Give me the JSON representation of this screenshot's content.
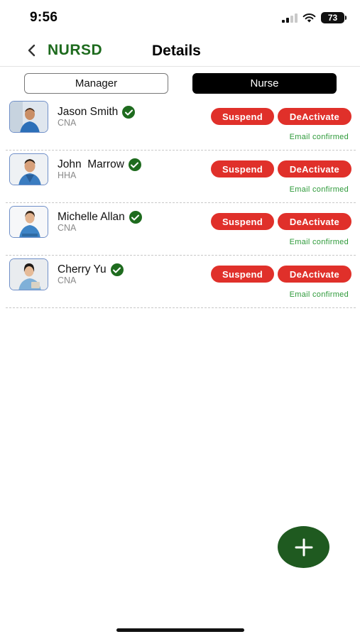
{
  "status_bar": {
    "time": "9:56",
    "battery": "73"
  },
  "header": {
    "brand": "NURSD",
    "title": "Details"
  },
  "tabs": [
    {
      "label": "Manager",
      "active": false
    },
    {
      "label": "Nurse",
      "active": true
    }
  ],
  "nurses": [
    {
      "name": "Jason Smith",
      "role": "CNA",
      "verified": true,
      "suspend_label": "Suspend",
      "deactivate_label": "DeActivate",
      "email_status": "Email confirmed"
    },
    {
      "name": "John  Marrow",
      "role": "HHA",
      "verified": true,
      "suspend_label": "Suspend",
      "deactivate_label": "DeActivate",
      "email_status": "Email confirmed"
    },
    {
      "name": "Michelle Allan",
      "role": "CNA",
      "verified": true,
      "suspend_label": "Suspend",
      "deactivate_label": "DeActivate",
      "email_status": "Email confirmed"
    },
    {
      "name": "Cherry Yu",
      "role": "CNA",
      "verified": true,
      "suspend_label": "Suspend",
      "deactivate_label": "DeActivate",
      "email_status": "Email confirmed"
    }
  ],
  "fab": {
    "icon": "plus-icon"
  },
  "colors": {
    "brand": "#1e6b1e",
    "danger_button": "#e0302a",
    "email_confirmed": "#2e9a3a",
    "fab": "#1f5a20",
    "verified_badge": "#1e6b1e"
  }
}
